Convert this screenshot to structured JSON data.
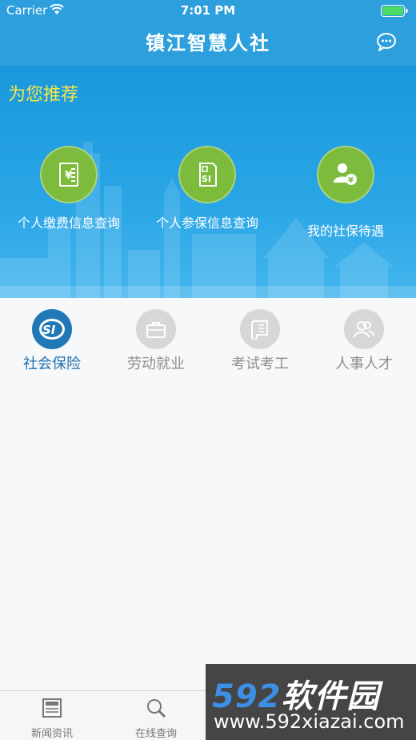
{
  "status_bar": {
    "carrier": "Carrier",
    "time": "7:01 PM"
  },
  "nav": {
    "title": "镇江智慧人社"
  },
  "recommend": {
    "title": "为您推荐",
    "items": [
      {
        "label": "个人缴费信息查询",
        "icon": "fee-receipt-icon"
      },
      {
        "label": "个人参保信息查询",
        "icon": "si-document-icon"
      },
      {
        "label": "我的社保待遇",
        "icon": "user-yuan-icon"
      }
    ]
  },
  "categories": [
    {
      "label": "社会保险",
      "icon": "si-logo-icon",
      "active": true
    },
    {
      "label": "劳动就业",
      "icon": "briefcase-icon",
      "active": false
    },
    {
      "label": "考试考工",
      "icon": "scroll-icon",
      "active": false
    },
    {
      "label": "人事人才",
      "icon": "people-icon",
      "active": false
    }
  ],
  "tabs": [
    {
      "label": "新闻资讯",
      "icon": "newspaper-icon"
    },
    {
      "label": "在线查询",
      "icon": "magnifier-icon"
    }
  ],
  "watermark": {
    "brand_num": "592",
    "brand_cn": "软件园",
    "url": "www.592xiazai.com"
  },
  "colors": {
    "header": "#2d9fdc",
    "recommend_title": "#f4e64a",
    "feature_circle": "#7cbb3b",
    "active_category": "#2178b6",
    "inactive_category": "#d7d7d7"
  }
}
